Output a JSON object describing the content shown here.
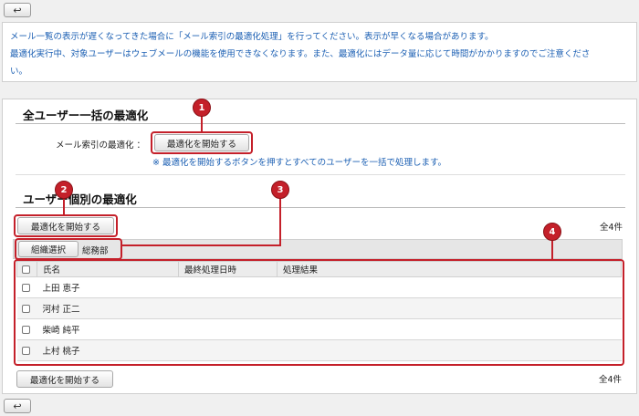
{
  "nav": {
    "back_icon": "↩"
  },
  "info": {
    "line1": "メール一覧の表示が遅くなってきた場合に「メール索引の最適化処理」を行ってください。表示が早くなる場合があります。",
    "line2": "最適化実行中、対象ユーザーはウェブメールの機能を使用できなくなります。また、最適化にはデータ量に応じて時間がかかりますのでご注意くださ",
    "line3": "い。"
  },
  "bulk": {
    "title": "全ユーザー一括の最適化",
    "field_label": "メール索引の最適化 ：",
    "start_button": "最適化を開始する",
    "note": "※ 最適化を開始するボタンを押すとすべてのユーザーを一括で処理します。"
  },
  "individual": {
    "title": "ユーザー個別の最適化",
    "start_button_top": "最適化を開始する",
    "start_button_bottom": "最適化を開始する",
    "count_top": "全4件",
    "count_bottom": "全4件",
    "org_select_button": "組織選択",
    "org_name": "総務部",
    "columns": [
      "氏名",
      "最終処理日時",
      "処理結果"
    ],
    "users": [
      {
        "name": "上田 恵子",
        "last_processed": "",
        "result": ""
      },
      {
        "name": "河村 正二",
        "last_processed": "",
        "result": ""
      },
      {
        "name": "柴崎 純平",
        "last_processed": "",
        "result": ""
      },
      {
        "name": "上村 桃子",
        "last_processed": "",
        "result": ""
      }
    ]
  },
  "markers": [
    "1",
    "2",
    "3",
    "4"
  ],
  "colors": {
    "accent_red": "#c4202a",
    "link_blue": "#1b5fb3"
  }
}
